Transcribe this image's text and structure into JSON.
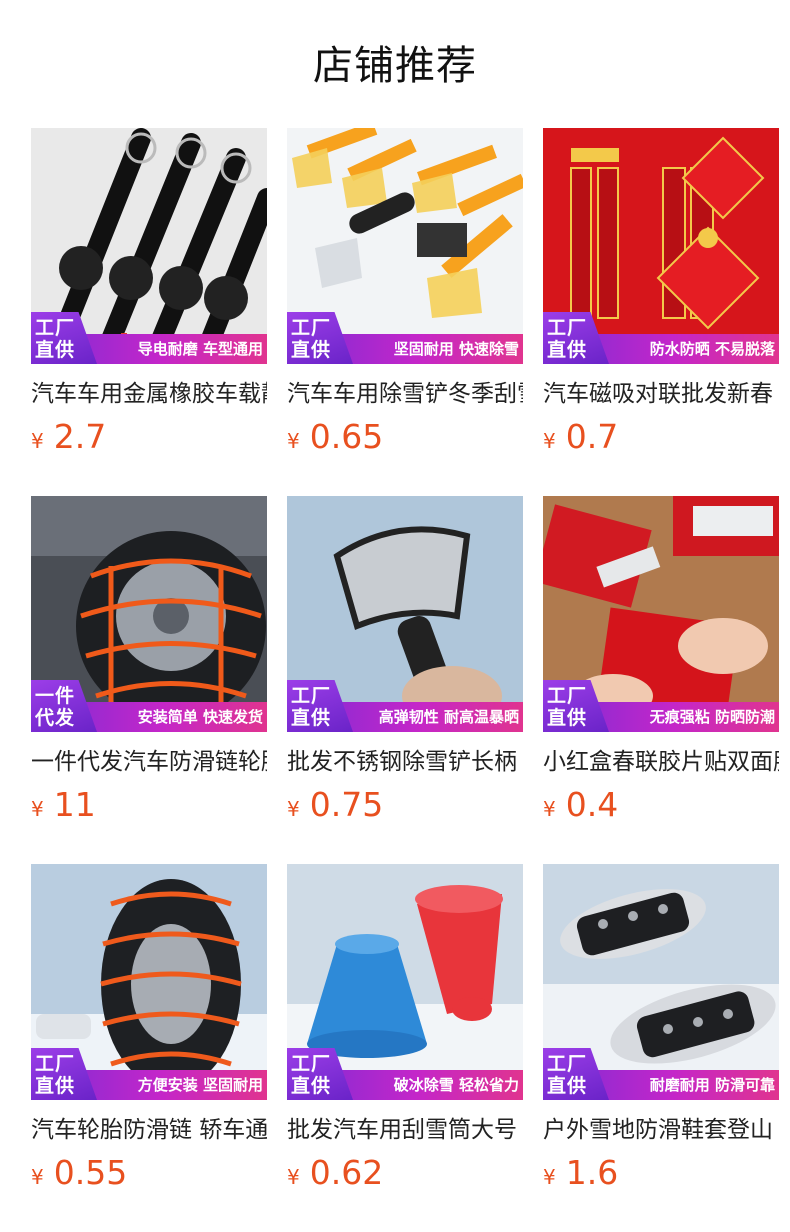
{
  "header": {
    "title": "店铺推荐"
  },
  "products": [
    {
      "name": "汽车车用金属橡胶车载静电带",
      "currency": "¥",
      "price": "2.7",
      "badge": "工厂\n直供",
      "tags": "导电耐磨 车型通用",
      "image": "static-strap-image"
    },
    {
      "name": "汽车车用除雪铲冬季刮雪板",
      "currency": "¥",
      "price": "0.65",
      "badge": "工厂\n直供",
      "tags": "坚固耐用 快速除雪",
      "image": "snow-shovel-image"
    },
    {
      "name": "汽车磁吸对联批发新春",
      "currency": "¥",
      "price": "0.7",
      "badge": "工厂\n直供",
      "tags": "防水防晒 不易脱落",
      "image": "couplet-image"
    },
    {
      "name": "一件代发汽车防滑链轮胎",
      "currency": "¥",
      "price": "11",
      "badge": "一件\n代发",
      "tags": "安装简单 快速发货",
      "image": "tire-chain-image"
    },
    {
      "name": "批发不锈钢除雪铲长柄",
      "currency": "¥",
      "price": "0.75",
      "badge": "工厂\n直供",
      "tags": "高弹韧性 耐高温暴晒",
      "image": "steel-scraper-image"
    },
    {
      "name": "小红盒春联胶片贴双面胶",
      "currency": "¥",
      "price": "0.4",
      "badge": "工厂\n直供",
      "tags": "无痕强粘 防晒防潮",
      "image": "red-box-image"
    },
    {
      "name": "汽车轮胎防滑链 轿车通用",
      "currency": "¥",
      "price": "0.55",
      "badge": "工厂\n直供",
      "tags": "方便安装 坚固耐用",
      "image": "snow-chain-image"
    },
    {
      "name": "批发汽车用刮雪筒大号",
      "currency": "¥",
      "price": "0.62",
      "badge": "工厂\n直供",
      "tags": "破冰除雪 轻松省力",
      "image": "cone-scraper-image"
    },
    {
      "name": "户外雪地防滑鞋套登山",
      "currency": "¥",
      "price": "1.6",
      "badge": "工厂\n直供",
      "tags": "耐磨耐用 防滑可靠",
      "image": "crampon-image"
    }
  ],
  "colors": {
    "price": "#e8501f",
    "banner_start": "#7a2cd6",
    "banner_end": "#e0348f"
  }
}
